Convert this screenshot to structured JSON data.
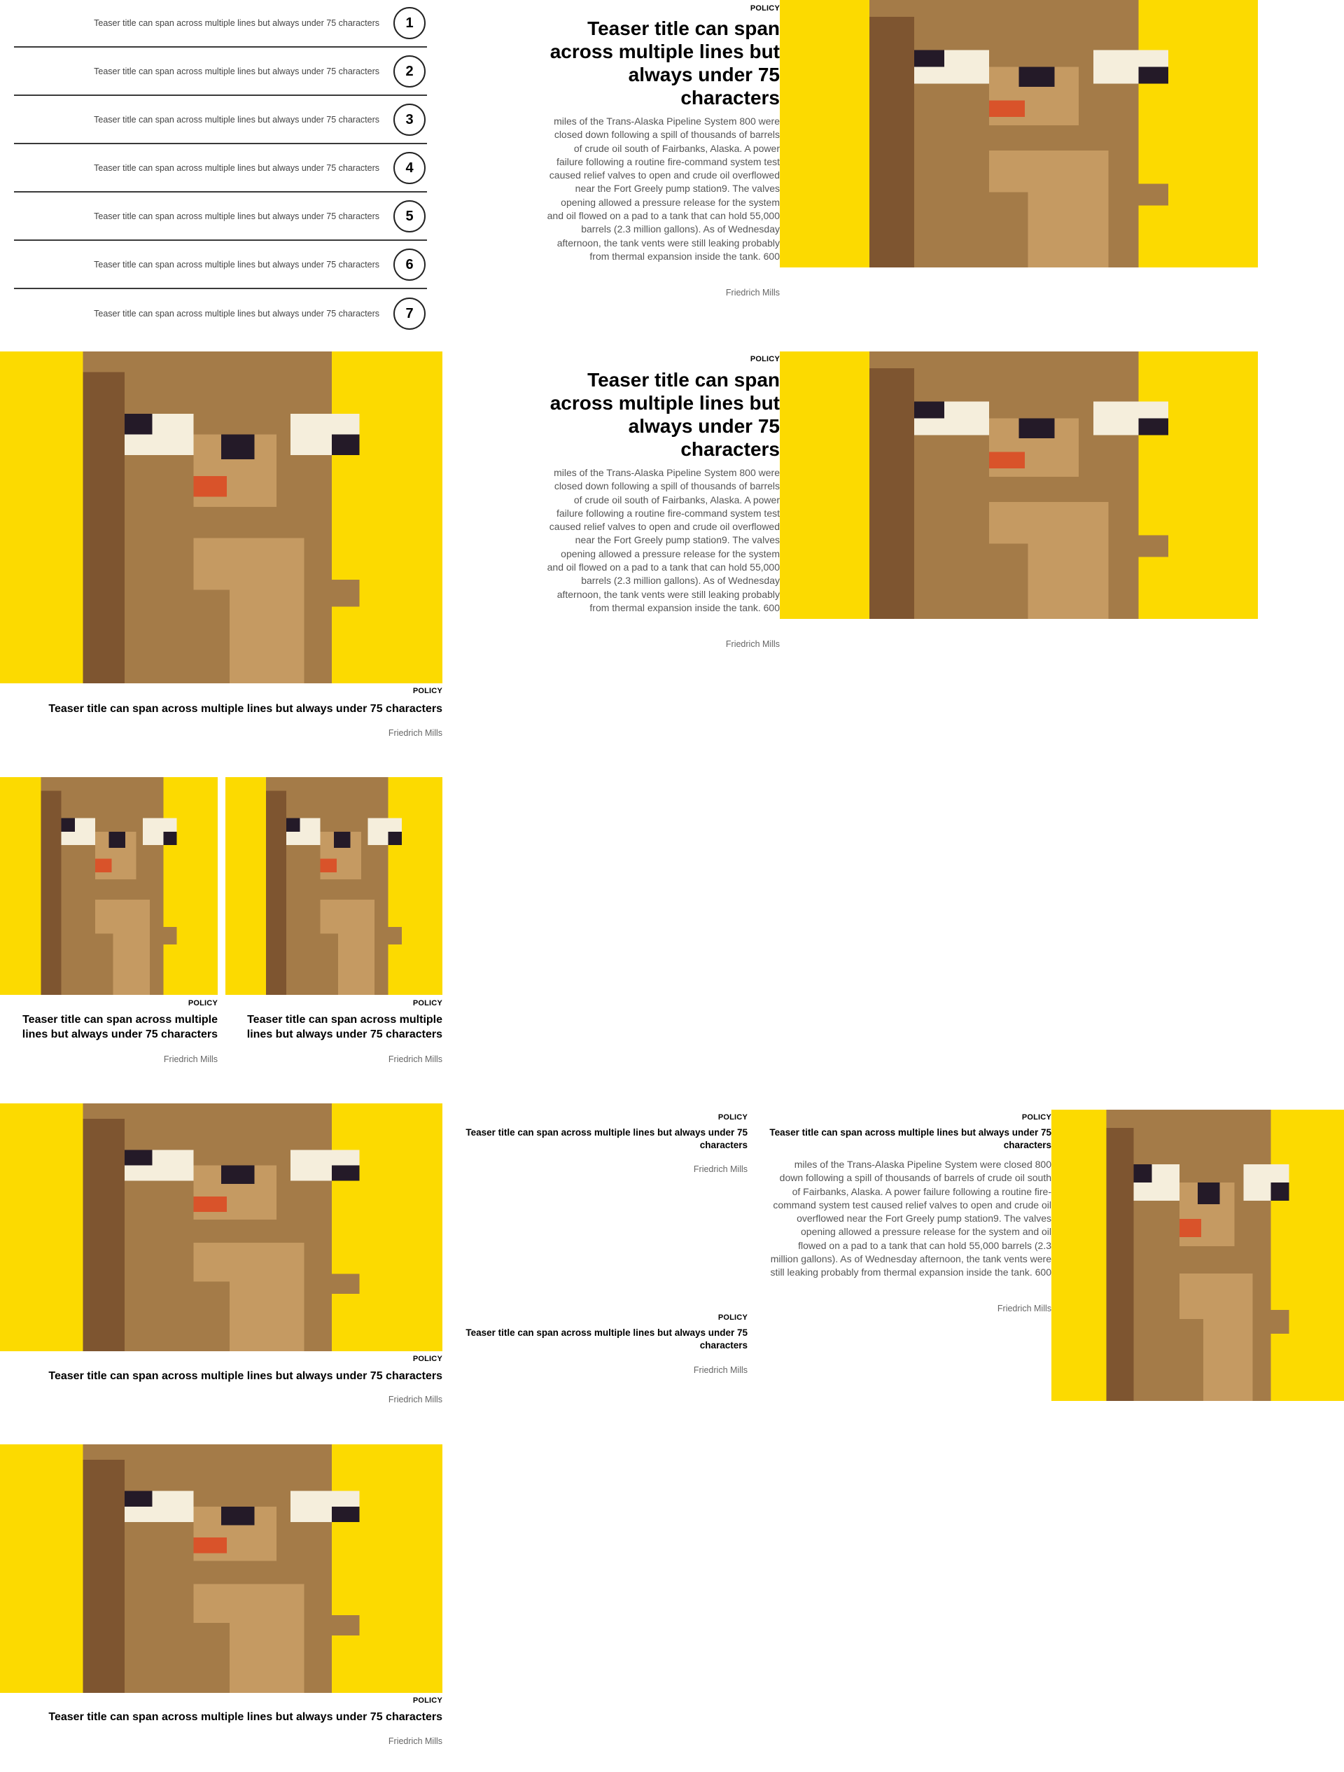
{
  "colors": {
    "mascot_bg": "#FCDA00",
    "mascot_dark": "#7E5530",
    "mascot_mid": "#A47B48",
    "mascot_light": "#C59A62",
    "mascot_eye_white": "#F5EEDC",
    "mascot_pupil": "#241A28",
    "mascot_tongue": "#D9532A",
    "rule": "#3a3a3a"
  },
  "ranked_list": [
    {
      "number": "1",
      "title": "Teaser title can span across multiple lines but always under 75 characters"
    },
    {
      "number": "2",
      "title": "Teaser title can span across multiple lines but always under 75 characters"
    },
    {
      "number": "3",
      "title": "Teaser title can span across multiple lines but always under 75 characters"
    },
    {
      "number": "4",
      "title": "Teaser title can span across multiple lines but always under 75 characters"
    },
    {
      "number": "5",
      "title": "Teaser title can span across multiple lines but always under 75 characters"
    },
    {
      "number": "6",
      "title": "Teaser title can span across multiple lines but always under 75 characters"
    },
    {
      "number": "7",
      "title": "Teaser title can span across multiple lines but always under 75 characters"
    }
  ],
  "feature_1": {
    "kicker": "POLICY",
    "title": "Teaser title can span across multiple lines but always under 75 characters",
    "body": "miles of the Trans-Alaska Pipeline System 800 were closed down following a spill of thousands of barrels of crude oil south of Fairbanks, Alaska. A power failure following a routine fire-command system test caused relief valves to open and crude oil overflowed near the Fort Greely pump station9. The valves opening allowed a pressure release for the system and oil flowed on a pad to a tank that can hold 55,000 barrels (2.3 million gallons). As of Wednesday afternoon, the tank vents were still leaking probably from thermal expansion inside the tank. 600",
    "byline": "Friedrich Mills",
    "image_icon": "mascot-image"
  },
  "feature_2": {
    "kicker": "POLICY",
    "title": "Teaser title can span across multiple lines but always under 75 characters",
    "body": "miles of the Trans-Alaska Pipeline System 800 were closed down following a spill of thousands of barrels of crude oil south of Fairbanks, Alaska. A power failure following a routine fire-command system test caused relief valves to open and crude oil overflowed near the Fort Greely pump station9. The valves opening allowed a pressure release for the system and oil flowed on a pad to a tank that can hold 55,000 barrels (2.3 million gallons). As of Wednesday afternoon, the tank vents were still leaking probably from thermal expansion inside the tank. 600",
    "byline": "Friedrich Mills"
  },
  "card_large_1": {
    "kicker": "POLICY",
    "title": "Teaser title can span across multiple lines but always under 75 characters",
    "byline": "Friedrich Mills"
  },
  "card_pair": [
    {
      "kicker": "POLICY",
      "title": "Teaser title can span across multiple lines but always under 75 characters",
      "byline": "Friedrich Mills"
    },
    {
      "kicker": "POLICY",
      "title": "Teaser title can span across multiple lines but always under 75 characters",
      "byline": "Friedrich Mills"
    }
  ],
  "card_large_2": {
    "kicker": "POLICY",
    "title": "Teaser title can span across multiple lines but always under 75 characters",
    "byline": "Friedrich Mills"
  },
  "text_teasers": [
    {
      "kicker": "POLICY",
      "title": "Teaser title can span across multiple lines but always under 75 characters",
      "byline": "Friedrich Mills"
    },
    {
      "kicker": "POLICY",
      "title": "Teaser title can span across multiple lines but always under 75 characters",
      "byline": "Friedrich Mills"
    }
  ],
  "feature_3": {
    "kicker": "POLICY",
    "title": "Teaser title can span across multiple lines but always under 75 characters",
    "body": "miles of the Trans-Alaska Pipeline System were closed 800 down following a spill of thousands of barrels of crude oil south of Fairbanks, Alaska. A power failure following a routine fire-command system test caused relief valves to open and crude oil overflowed near the Fort Greely pump station9. The valves opening allowed a pressure release for the system and oil flowed on a pad to a tank that can hold 55,000 barrels (2.3 million gallons). As of Wednesday afternoon, the tank vents were still leaking probably from thermal expansion inside the tank. 600",
    "byline": "Friedrich Mills"
  },
  "card_large_3": {
    "kicker": "POLICY",
    "title": "Teaser title can span across multiple lines but always under 75 characters",
    "byline": "Friedrich Mills"
  }
}
